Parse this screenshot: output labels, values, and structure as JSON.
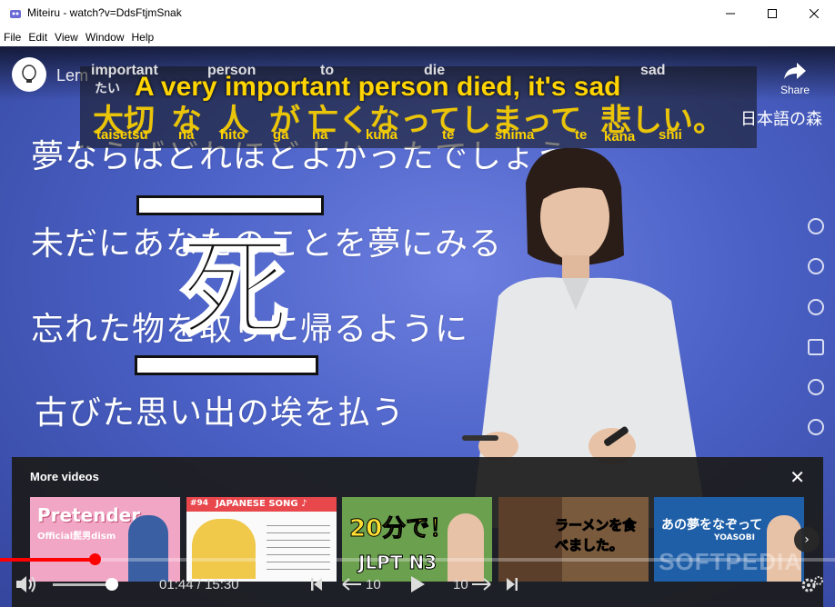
{
  "window": {
    "title": "Miteiru - watch?v=DdsFtjmSnak"
  },
  "menu": {
    "items": [
      "File",
      "Edit",
      "View",
      "Window",
      "Help"
    ]
  },
  "video": {
    "channel_title": "Lem",
    "share_label": "Share",
    "logo_text": "日本語の森",
    "big_kanji": "死",
    "lyrics_lines": [
      "夢ならばどれほどよかったでしょう",
      "未だにあなたのことを夢にみる",
      "忘れた物を取りに帰るように",
      "古びた思い出の埃を払う"
    ]
  },
  "subtitle": {
    "english": "A very important person died, it's sad",
    "top_words": [
      "important",
      "person",
      "to",
      "die",
      "sad"
    ],
    "top_small": "たい",
    "japanese_tokens": [
      "大切",
      "な",
      "人",
      "が",
      "亡くなってしまって",
      "悲しい",
      "。"
    ],
    "romaji": [
      "taisetsu",
      "na",
      "hito",
      "ga",
      "na",
      "kuna",
      "te",
      "shima",
      "te",
      "kana",
      "shii"
    ]
  },
  "more_videos": {
    "title": "More videos",
    "thumbnails": [
      {
        "main": "Pretender",
        "sub": "Official髭男dism",
        "bg": "#f2a6c6"
      },
      {
        "main": "JAPANESE SONG ♪",
        "sub": "#94",
        "bg": "#fafafa"
      },
      {
        "main": "20分で！",
        "sub": "JLPT N3",
        "bg": "#6aa04e"
      },
      {
        "main": "ラーメンを食べました。",
        "sub": "",
        "bg": "#7a5a3c"
      },
      {
        "main": "あの夢をなぞって",
        "sub": "YOASOBI",
        "bg": "#1f5fa8"
      }
    ]
  },
  "player": {
    "current_time": "01:44",
    "separator": " / ",
    "duration": "15:30",
    "progress": 0.113,
    "volume": 0.9,
    "skip_back_label": "10",
    "skip_forward_label": "10"
  },
  "watermark": "SOFTPEDIA"
}
